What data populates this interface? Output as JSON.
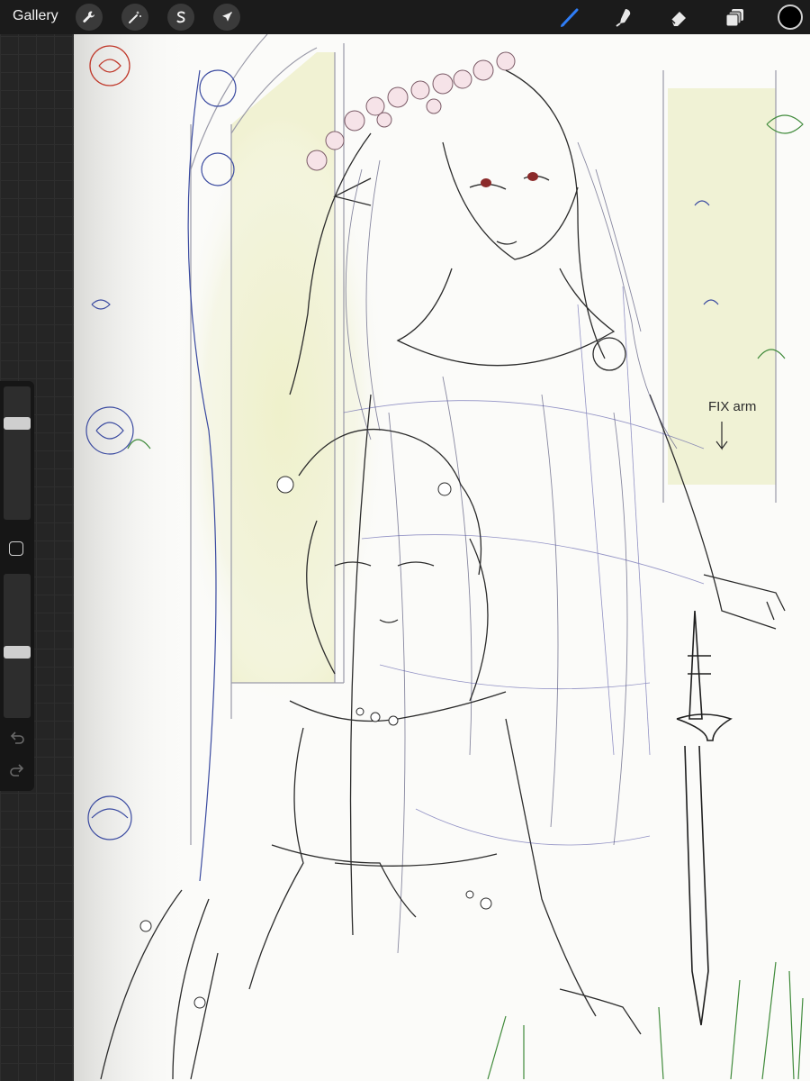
{
  "topbar": {
    "gallery_label": "Gallery",
    "left_tools": [
      "wrench-icon",
      "magic-wand-icon",
      "selection-s-icon",
      "transform-arrow-icon"
    ],
    "right_tools": [
      "brush-icon",
      "smudge-icon",
      "eraser-icon",
      "layers-icon"
    ],
    "active_tool": "brush-icon",
    "active_tool_color": "#2f7df6",
    "current_color": "#000000"
  },
  "sidebar": {
    "brush_size_level": 0.75,
    "opacity_level": 0.45,
    "controls": [
      "brush-size-slider",
      "modify-button",
      "opacity-slider",
      "undo-icon",
      "redo-icon"
    ]
  },
  "canvas": {
    "annotation_text": "FIX arm",
    "background_color": "#fbfbf9",
    "window_glow_color": "#eef0c8"
  }
}
